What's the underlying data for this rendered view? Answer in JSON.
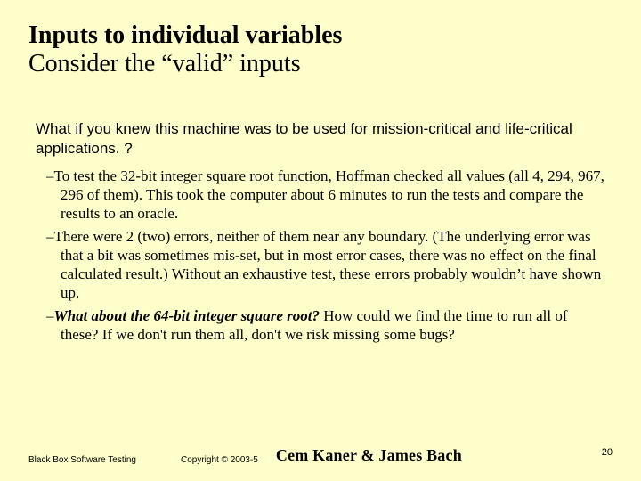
{
  "title": {
    "line1": "Inputs to individual variables",
    "line2": "Consider the “valid” inputs"
  },
  "intro": "What if you knew this machine was to be used for mission-critical and life-critical applications. ?",
  "bullets": [
    {
      "dash": "–",
      "text": "To test the 32-bit integer square root function, Hoffman checked all values (all 4, 294, 967, 296 of them). This took the computer about 6 minutes to run the tests and compare the results to an oracle."
    },
    {
      "dash": "–",
      "text": "There were 2 (two) errors, neither of them near any boundary. (The underlying error was that a bit was sometimes mis-set, but in most error cases, there was no effect on the final calculated result.) Without an exhaustive test, these errors probably wouldn’t have shown up."
    },
    {
      "dash": "–",
      "bold": "What about the 64-bit integer square root?",
      "text": " How could we find the time to run all of these? If we don't run them all, don't we risk missing some bugs?"
    }
  ],
  "footer": {
    "left": "Black Box Software Testing",
    "copyright": "Copyright © 2003-5",
    "authors": "Cem Kaner & James Bach",
    "page": "20"
  }
}
